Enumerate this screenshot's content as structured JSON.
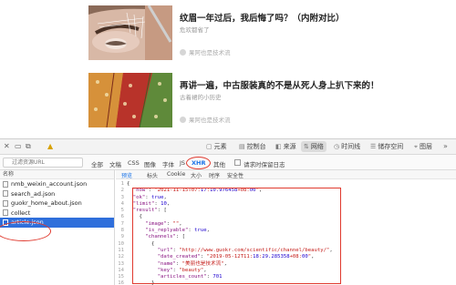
{
  "articles": [
    {
      "title": "纹眉一年过后，我后悔了吗？（内附对比）",
      "subtitle": "危欢都省了",
      "meta": "果阿也是技术流"
    },
    {
      "title": "再讲一遍，中古服装真的不是从死人身上扒下来的！",
      "subtitle": "古着裙的小历史",
      "meta": "果阿也是技术流"
    }
  ],
  "devtools": {
    "tabs": [
      {
        "icon": "▢",
        "label": "元素"
      },
      {
        "icon": "▤",
        "label": "控制台"
      },
      {
        "icon": "◧",
        "label": "来源"
      },
      {
        "icon": "⇅",
        "label": "网络"
      },
      {
        "icon": "◷",
        "label": "时间线"
      },
      {
        "icon": "☰",
        "label": "储存空间"
      },
      {
        "icon": "⌖",
        "label": "图层"
      }
    ],
    "filter": {
      "placeholder": "过滤资源URL",
      "types": [
        "全部",
        "文稿",
        "CSS",
        "图像",
        "字体",
        "JS",
        "XHR",
        "其他"
      ],
      "selected": "XHR",
      "preserve_log": "请求时保留日志"
    },
    "requests_header": "名称",
    "requests": [
      "nmb_weixin_account.json",
      "search_ad.json",
      "guokr_home_about.json",
      "collect",
      "article.json"
    ],
    "selected_request": "article.json",
    "detail_tabs": [
      "预览",
      "标头",
      "Cookie",
      "大小",
      "时序",
      "安全性"
    ],
    "active_detail_tab": "预览",
    "code_lines": [
      "{",
      "  \"now\": \"2021-11-15T07:17:10.976458+08:00\",",
      "  \"ok\": true,",
      "  \"limit\": 10,",
      "  \"result\": [",
      "    {",
      "      \"image\": \"\",",
      "      \"is_replyable\": true,",
      "      \"channels\": [",
      "        {",
      "          \"url\": \"http://www.guokr.com/scientific/channel/beauty/\",",
      "          \"date_created\": \"2019-05-12T11:18:29.285358+08:00\",",
      "          \"name\": \"美丽也是技术流\",",
      "          \"key\": \"beauty\",",
      "          \"articles_count\": 701",
      "        }",
      "      ],"
    ]
  },
  "colors": {
    "annotation_red": "#e03a2f",
    "selection_blue": "#2f6fdb",
    "link_blue": "#1a73e8"
  }
}
